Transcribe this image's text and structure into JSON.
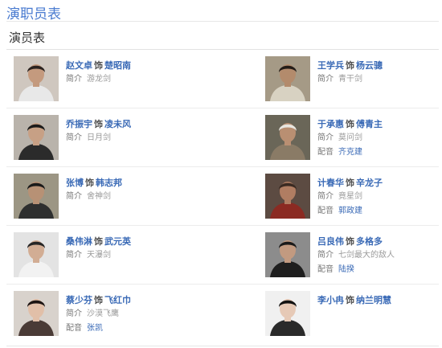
{
  "page": {
    "title": "演职员表"
  },
  "section": {
    "title": "演员表"
  },
  "labels": {
    "connector": "饰",
    "intro": "简介",
    "dub": "配音"
  },
  "cast": [
    {
      "actor": "赵文卓",
      "role": "楚昭南",
      "intro": "游龙剑",
      "dub": "",
      "photo": {
        "bg": "#cfc7bf",
        "shirt": "#e8e8e8",
        "hair": "#2b2320",
        "skin": "#c49a7e"
      }
    },
    {
      "actor": "王学兵",
      "role": "杨云骢",
      "intro": "青干剑",
      "dub": "",
      "photo": {
        "bg": "#a59a86",
        "shirt": "#d8d2c2",
        "hair": "#231c17",
        "skin": "#b38b6c"
      }
    },
    {
      "actor": "乔振宇",
      "role": "凌未风",
      "intro": "日月剑",
      "dub": "",
      "photo": {
        "bg": "#b9b3ab",
        "shirt": "#2b2b2b",
        "hair": "#1b1b1b",
        "skin": "#c7a085"
      }
    },
    {
      "actor": "于承惠",
      "role": "傅青主",
      "intro": "莫问剑",
      "dub": "齐克建",
      "photo": {
        "bg": "#6a6658",
        "shirt": "#8a7b66",
        "hair": "#e8e6e0",
        "skin": "#b98f72"
      }
    },
    {
      "actor": "张博",
      "role": "韩志邦",
      "intro": "舍神剑",
      "dub": "",
      "photo": {
        "bg": "#9c9684",
        "shirt": "#2e2f2f",
        "hair": "#1a1a1a",
        "skin": "#b79175"
      }
    },
    {
      "actor": "计春华",
      "role": "辛龙子",
      "intro": "竟星剑",
      "dub": "郭政建",
      "photo": {
        "bg": "#5c4b42",
        "shirt": "#8b2a22",
        "hair": "#3a2a22",
        "skin": "#b07d62"
      }
    },
    {
      "actor": "桑伟淋",
      "role": "武元英",
      "intro": "天瀑剑",
      "dub": "",
      "photo": {
        "bg": "#e3e3e3",
        "shirt": "#f2f2f2",
        "hair": "#262626",
        "skin": "#d2ad94"
      }
    },
    {
      "actor": "吕良伟",
      "role": "多格多",
      "intro": "七剑最大的敌人",
      "dub": "陆揆",
      "photo": {
        "bg": "#8c8c8c",
        "shirt": "#1e1e1e",
        "hair": "#1a1a1a",
        "skin": "#c29a80"
      }
    },
    {
      "actor": "蔡少芬",
      "role": "飞红巾",
      "intro": "沙漠飞鹰",
      "dub": "张凯",
      "photo": {
        "bg": "#d8d2cc",
        "shirt": "#4a3b36",
        "hair": "#1c1412",
        "skin": "#e1bfa8"
      }
    },
    {
      "actor": "李小冉",
      "role": "纳兰明慧",
      "intro": "",
      "dub": "",
      "photo": {
        "bg": "#f0f0f0",
        "shirt": "#2a2a2a",
        "hair": "#111111",
        "skin": "#e6c9b6"
      }
    }
  ]
}
